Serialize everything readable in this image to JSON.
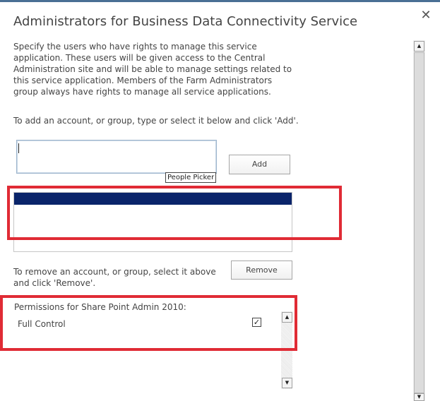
{
  "dialog": {
    "title": "Administrators for Business Data Connectivity Service",
    "close_glyph": "✕"
  },
  "description": "Specify the users who have rights to manage this service application. These users will be given access to the Central Administration site and will be able to manage settings related to this service application. Members of the Farm Administrators group always have rights to manage all service applications.",
  "add_instruction": "To add an account, or group, type or select it below and click 'Add'.",
  "people_picker": {
    "value": "",
    "tooltip": "People Picker"
  },
  "buttons": {
    "add_label": "Add",
    "remove_label": "Remove"
  },
  "remove_instruction": "To remove an account, or group, select it above and click 'Remove'.",
  "permissions": {
    "heading": "Permissions for Share Point Admin 2010:",
    "items": [
      {
        "name": "Full Control",
        "checked": true,
        "check_glyph": "✓"
      }
    ]
  },
  "scroll_glyphs": {
    "up": "▲",
    "down": "▼"
  },
  "colors": {
    "highlight_red": "#e02b35",
    "selection_navy": "#0a246a"
  }
}
